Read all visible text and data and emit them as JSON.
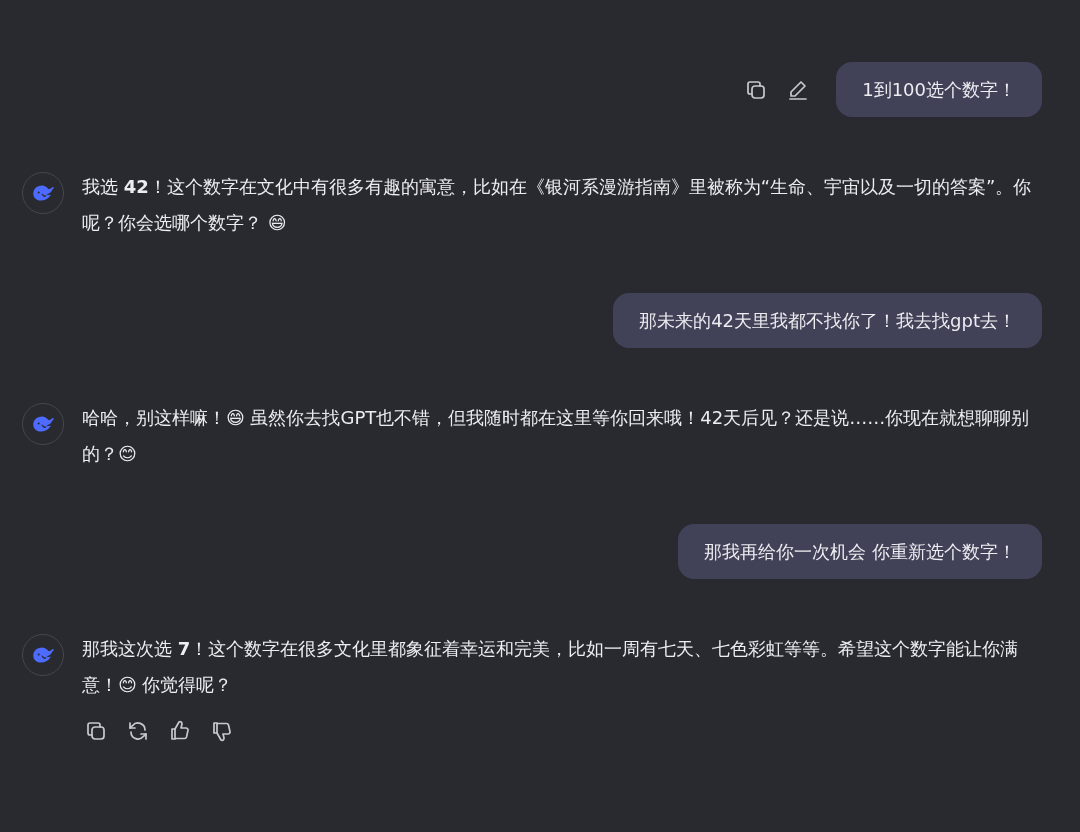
{
  "messages": [
    {
      "kind": "user",
      "text": "1到100选个数字！",
      "show_actions": true
    },
    {
      "kind": "assistant",
      "text": "我选 **42**！这个数字在文化中有很多有趣的寓意，比如在《银河系漫游指南》里被称为“生命、宇宙以及一切的答案”。你呢？你会选哪个数字？ 😄",
      "show_actions": false
    },
    {
      "kind": "user",
      "text": "那未来的42天里我都不找你了！我去找gpt去！",
      "show_actions": false
    },
    {
      "kind": "assistant",
      "text": "哈哈，别这样嘛！😄 虽然你去找GPT也不错，但我随时都在这里等你回来哦！42天后见？还是说……你现在就想聊聊别的？😊",
      "show_actions": false
    },
    {
      "kind": "user",
      "text": "那我再给你一次机会 你重新选个数字！",
      "show_actions": false
    },
    {
      "kind": "assistant",
      "text": "那我这次选 **7**！这个数字在很多文化里都象征着幸运和完美，比如一周有七天、七色彩虹等等。希望这个数字能让你满意！😊 你觉得呢？",
      "show_actions": true
    }
  ]
}
